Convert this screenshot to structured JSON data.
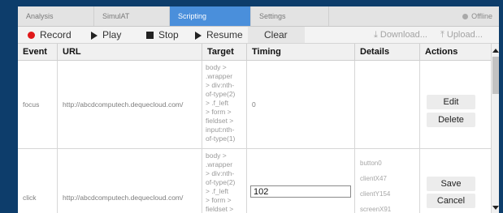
{
  "tabs": [
    {
      "label": "Analysis"
    },
    {
      "label": "SimulAT"
    },
    {
      "label": "Scripting"
    },
    {
      "label": "Settings"
    }
  ],
  "status": {
    "label": "Offline"
  },
  "toolbar": {
    "record": "Record",
    "play": "Play",
    "stop": "Stop",
    "resume": "Resume",
    "clear": "Clear",
    "download": "Download...",
    "upload": "Upload..."
  },
  "columns": [
    "Event",
    "URL",
    "Target",
    "Timing",
    "Details",
    "Actions"
  ],
  "rows": [
    {
      "event": "focus",
      "url": "http://abcdcomputech.dequecloud.com/",
      "target": "body >\n.wrapper\n> div:nth-\nof-type(2)\n> .f_left\n> form >\nfieldset >\ninput:nth-\nof-type(1)",
      "timing": "0",
      "details": [],
      "actions": [
        "Edit",
        "Delete"
      ]
    },
    {
      "event": "click",
      "url": "http://abcdcomputech.dequecloud.com/",
      "target": "body >\n.wrapper\n> div:nth-\nof-type(2)\n> .f_left\n> form >\nfieldset >",
      "timing_input": "102",
      "details": [
        "button0",
        "clientX47",
        "clientY154",
        "screenX91"
      ],
      "actions": [
        "Save",
        "Cancel"
      ]
    }
  ]
}
